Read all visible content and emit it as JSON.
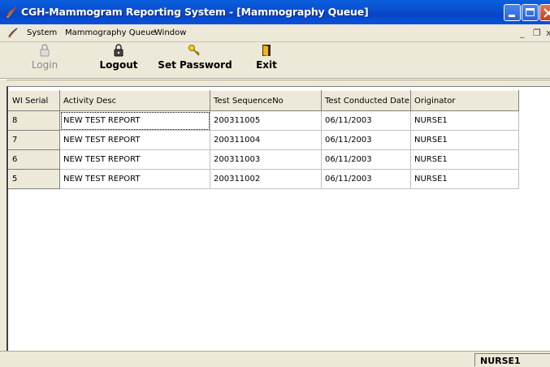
{
  "window": {
    "title": "CGH-Mammogram Reporting System - [Mammography Queue]"
  },
  "menubar": {
    "items": [
      "System",
      "Mammography Queue",
      "Window"
    ]
  },
  "toolbar": {
    "login_label": "Login",
    "logout_label": "Logout",
    "set_password_label": "Set Password",
    "exit_label": "Exit"
  },
  "grid": {
    "columns": [
      "WI Serial",
      "Activity Desc",
      "Test SequenceNo",
      "Test Conducted Date",
      "Originator"
    ],
    "rows": [
      [
        "8",
        "NEW TEST REPORT",
        "200311005",
        "06/11/2003",
        "NURSE1"
      ],
      [
        "7",
        "NEW TEST REPORT",
        "200311004",
        "06/11/2003",
        "NURSE1"
      ],
      [
        "6",
        "NEW TEST REPORT",
        "200311003",
        "06/11/2003",
        "NURSE1"
      ],
      [
        "5",
        "NEW TEST REPORT",
        "200311002",
        "06/11/2003",
        "NURSE1"
      ]
    ]
  },
  "statusbar": {
    "user": "NURSE1"
  },
  "colors": {
    "titlebar": "#0a53d9",
    "chrome": "#ece9d8",
    "grid_bg": "#ffffff"
  }
}
